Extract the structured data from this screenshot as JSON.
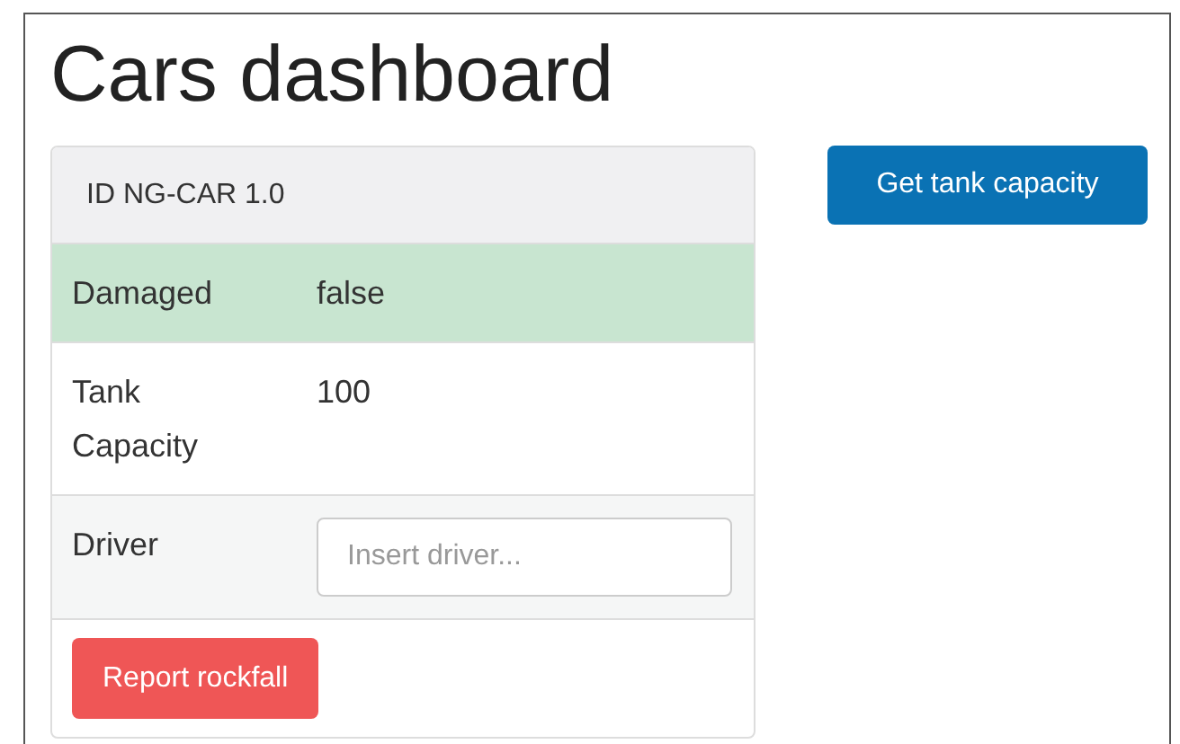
{
  "title": "Cars dashboard",
  "panel": {
    "heading": "ID NG-CAR 1.0",
    "rows": [
      {
        "kind": "success",
        "label": "Damaged",
        "value": "false"
      },
      {
        "kind": "text",
        "label": "Tank Capacity",
        "value": "100"
      },
      {
        "kind": "input",
        "label": "Driver",
        "placeholder": "Insert driver..."
      }
    ],
    "footer_button": "Report rockfall"
  },
  "side_button": "Get tank capacity"
}
